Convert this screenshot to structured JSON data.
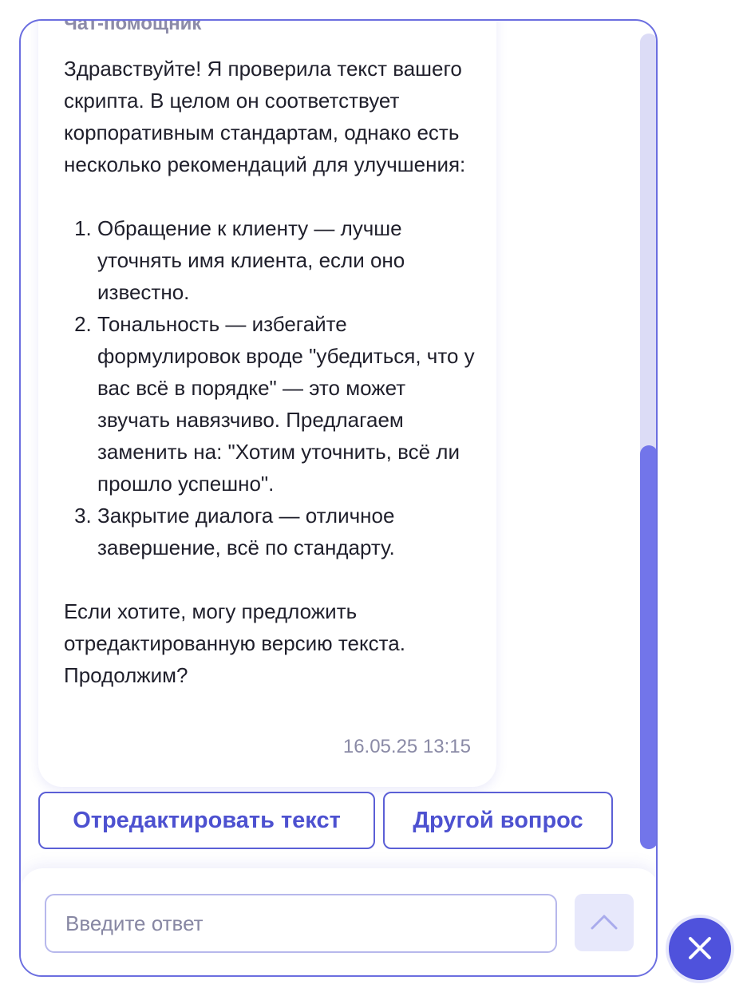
{
  "chat": {
    "sender_name": "Чат-помощник",
    "message": {
      "intro": "Здравствуйте! Я проверила текст вашего скрипта. В целом он соответствует корпоративным стандартам, однако есть несколько рекомендаций для улучшения:",
      "items": [
        "Обращение к клиенту — лучше уточнять имя клиента, если оно известно.",
        "Тональность — избегайте формулировок вроде \"убедиться, что у вас всё в порядке\" — это может звучать навязчиво. Предлагаем заменить на: \"Хотим уточнить, всё ли прошло успешно\".",
        "Закрытие диалога — отличное завершение, всё по стандарту."
      ],
      "outro": "Если хотите, могу предложить отредактированную версию текста. Продолжим?",
      "timestamp": "16.05.25 13:15"
    },
    "quick_replies": [
      "Отредактировать текст",
      "Другой вопрос"
    ]
  },
  "composer": {
    "input_value": "",
    "input_placeholder": "Введите ответ",
    "send_icon": "chevron-up-icon"
  },
  "close_icon": "close-icon",
  "colors": {
    "accent": "#4f52dc",
    "border": "#6b6ee0",
    "scroll_track": "#dcdcf6",
    "scroll_thumb": "#7275ea"
  }
}
